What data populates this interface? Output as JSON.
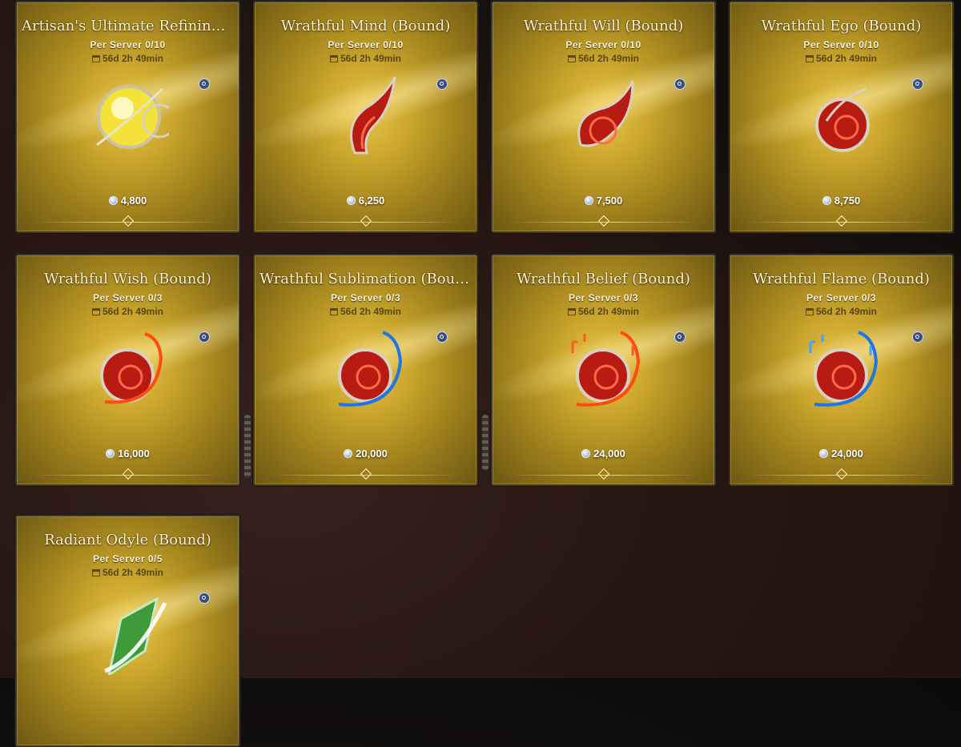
{
  "items": [
    {
      "title": "Artisan's Ultimate Refining Sto...",
      "limit": "Per Server  0/10",
      "timer": "56d 2h 49min",
      "price": "4,800",
      "icon": "yellow-orb-stone-icon"
    },
    {
      "title": "Wrathful Mind (Bound)",
      "limit": "Per Server  0/10",
      "timer": "56d 2h 49min",
      "price": "6,250",
      "icon": "red-flame-feather-icon"
    },
    {
      "title": "Wrathful Will (Bound)",
      "limit": "Per Server  0/10",
      "timer": "56d 2h 49min",
      "price": "7,500",
      "icon": "red-flame-swirl-icon"
    },
    {
      "title": "Wrathful Ego (Bound)",
      "limit": "Per Server  0/10",
      "timer": "56d 2h 49min",
      "price": "8,750",
      "icon": "red-flame-orb-icon"
    },
    {
      "title": "Wrathful Wish (Bound)",
      "limit": "Per Server  0/3",
      "timer": "56d 2h 49min",
      "price": "16,000",
      "icon": "red-flame-ring-orange-icon"
    },
    {
      "title": "Wrathful Sublimation (Bound)",
      "limit": "Per Server  0/3",
      "timer": "56d 2h 49min",
      "price": "20,000",
      "icon": "red-flame-ring-blue-icon"
    },
    {
      "title": "Wrathful Belief (Bound)",
      "limit": "Per Server  0/3",
      "timer": "56d 2h 49min",
      "price": "24,000",
      "icon": "red-flame-ring-runes-icon"
    },
    {
      "title": "Wrathful Flame (Bound)",
      "limit": "Per Server  0/3",
      "timer": "56d 2h 49min",
      "price": "24,000",
      "icon": "red-flame-ring-blue-runes-icon"
    },
    {
      "title": "Radiant Odyle (Bound)",
      "limit": "Per Server  0/5",
      "timer": "56d 2h 49min",
      "price": "",
      "icon": "green-crystal-feather-icon"
    }
  ],
  "colors": {
    "card_gold": "#c9a52c",
    "border": "#3a3524",
    "timer_text": "#5a4612",
    "title_text": "#fbf3dc"
  }
}
